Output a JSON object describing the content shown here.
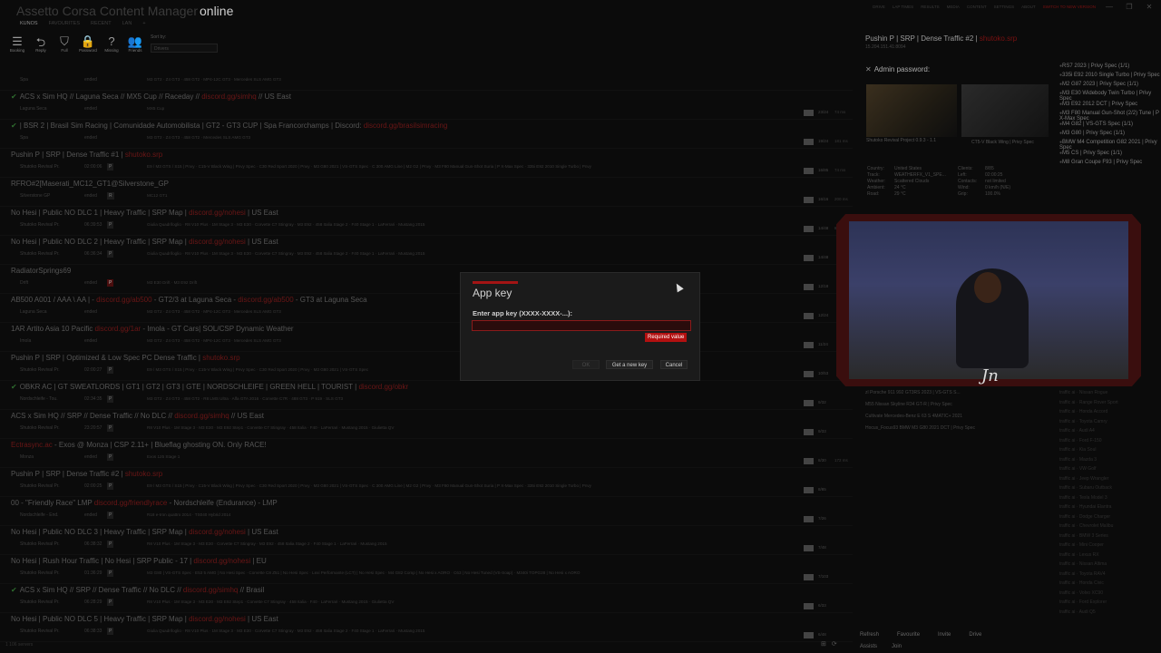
{
  "app": {
    "brand_prefix": "Assetto Corsa Content Manager",
    "brand": "online"
  },
  "nav_tabs": [
    "KUNOS",
    "FAVOURITES",
    "RECENT",
    "LAN",
    "+"
  ],
  "window_controls": [
    "—",
    "❐",
    "✕"
  ],
  "top_menu": [
    "DRIVE",
    "LAP TIMES",
    "RESULTS",
    "MEDIA",
    "CONTENT",
    "SETTINGS",
    "ABOUT"
  ],
  "update_text": "SWITCH TO NEW VERSION",
  "toolbar": [
    {
      "label": "Booking",
      "icon": "booking-icon",
      "glyph": "☰"
    },
    {
      "label": "Reply",
      "icon": "reply-icon",
      "glyph": "⮌"
    },
    {
      "label": "Full",
      "icon": "full-icon",
      "glyph": "⛉"
    },
    {
      "label": "Password",
      "icon": "lock-icon",
      "glyph": "🔒"
    },
    {
      "label": "Missing",
      "icon": "question-icon",
      "glyph": "?"
    },
    {
      "label": "Friends",
      "icon": "friends-icon",
      "glyph": "👥"
    }
  ],
  "sort": {
    "label": "Sort by:",
    "value": "Drivers"
  },
  "servers": [
    {
      "name": "",
      "track": "Spa",
      "state": "ended",
      "pill": "",
      "cars": "M3 GT2   ·   Z4 GT3   ·   458 GT2   ·   MP4-12C GT3   ·   Mercedes SLS AMG GT3",
      "count": "",
      "ping": ""
    },
    {
      "check": true,
      "name": "ACS x Sim HQ // Laguna Seca // MX5 Cup // Raceday // ",
      "red": "discord.gg/simhq",
      "name_after": " // US East",
      "track": "Laguna Seca",
      "state": "ended",
      "pill": "",
      "cars": "MX5 Cup",
      "count": "23/24",
      "ping": "74 ms"
    },
    {
      "check": true,
      "name": "| BSR 2 | Brasil Sim Racing | Comunidade Automobilista | GT2 - GT3 CUP | Spa Francorchamps | Discord: ",
      "red": "discord.gg/brasilsimracing",
      "name_after": "",
      "track": "Spa",
      "state": "ended",
      "pill": "",
      "cars": "M3 GT2   ·   Z4 GT3   ·   458 GT2   ·   Mercedes SLS AMG GT3",
      "count": "19/24",
      "ping": "181 ms"
    },
    {
      "name": "Pushin P | SRP | Dense Traffic #1 | ",
      "red": "shutoko.srp",
      "name_after": "",
      "track": "Shutoko Revival Pr.",
      "state": "02:00:06",
      "pill": "P",
      "cars": "E9 / M3 GTS / S15 | Pnvy   ·   C15-V Black Wing | Pnvy Spec   ·   C30 Red Sport 2020 | Pnvy   ·   M3 G80 2021 | VS-GTS Spec   ·   C 300 AMG Line | M2 G2 | Pnvy   ·   M3 F80 Manual Gun-Shot Suria | P X-Max Spec   ·   335i E92 2010 Single Turbo | Pnvy",
      "count": "16/85",
      "ping": "74 ms"
    },
    {
      "name": "RFRO#2[Maserati_MC12_GT1@Silverstone_GP",
      "red": "",
      "name_after": "",
      "track": "Silverstone GP",
      "state": "ended",
      "pill": "R",
      "cars": "MC12 GT1",
      "count": "16/16",
      "ping": "200 ms"
    },
    {
      "name": "No Hesi | Public NO DLC 1 | Heavy Traffic | SRP Map | ",
      "red": "discord.gg/nohesi",
      "name_after": " | US East",
      "track": "Shutoko Revival Pr.",
      "state": "06:39:53",
      "pill": "P",
      "cars": "Giulia Quadrifoglio   ·   R8 V10 Plus   ·   1M Stage 3   ·   M3 E30   ·   Corvette C7 Stingray   ·   M3 E92   ·   458 Italia Stage 2   ·   F40 Stage 1   ·   LaFerrari   ·   Mustang 2015",
      "count": "14/48",
      "ping": "82 ms"
    },
    {
      "name": "No Hesi | Public NO DLC 2 | Heavy Traffic | SRP Map | ",
      "red": "discord.gg/nohesi",
      "name_after": " | US East",
      "track": "Shutoko Revival Pr.",
      "state": "06:36:34",
      "pill": "P",
      "cars": "Giulia Quadrifoglio   ·   R8 V10 Plus   ·   1M Stage 3   ·   M3 E30   ·   Corvette C7 Stingray   ·   M3 E92   ·   458 Italia Stage 2   ·   F40 Stage 1   ·   LaFerrari   ·   Mustang 2015",
      "count": "14/48",
      "ping": ""
    },
    {
      "name": "RadiatorSprings69",
      "red": "",
      "name_after": "",
      "track": "Drift",
      "state": "ended",
      "pill": "P",
      "pill_red": true,
      "cars": "M3 E30 Drift   ·   M3 E92 Drift",
      "count": "12/18",
      "ping": ""
    },
    {
      "name": "AB500 A001 / AAA \\ AA | - ",
      "red": "discord.gg/ab500",
      "name_after": " - GT2/3 at Laguna Seca - ",
      "red2": "discord.gg/ab500",
      "name_after2": " - GT3 at Laguna Seca",
      "track": "Laguna Seca",
      "state": "ended",
      "pill": "",
      "cars": "M3 GT2   ·   Z4 GT3   ·   458 GT2   ·   MP4-12C GT3   ·   Mercedes SLS AMG GT3",
      "count": "12/24",
      "ping": ""
    },
    {
      "name": "1AR Artito Asia 10 Pacific ",
      "red": "discord.gg/1ar",
      "name_after": " - Imola - GT Cars| SOL/CSP Dynamic Weather",
      "track": "Imola",
      "state": "ended",
      "pill": "",
      "cars": "M3 GT2   ·   Z4 GT3   ·   458 GT2   ·   MP4-12C GT3   ·   Mercedes SLS AMG GT3",
      "count": "11/24",
      "ping": ""
    },
    {
      "name": "Pushin P | SRP | Optimized & Low Spec PC Dense Traffic | ",
      "red": "shutoko.srp",
      "name_after": "",
      "track": "Shutoko Revival Pr.",
      "state": "02:00:27",
      "pill": "P",
      "cars": "E9 / M3 GTS / S15 | Pnvy   ·   C15-V Black Wing | Pnvy Spec   ·   C30 Red Sport 2020 | Pnvy   ·   M3 G80 2021 | VS-GTS Spec",
      "count": "10/53",
      "ping": ""
    },
    {
      "check": true,
      "name": "OBKR AC | GT SWEATLORDS | GT1 | GT2 | GT3 | GTE | NORDSCHLEIFE | GREEN HELL | TOURIST | ",
      "red": "discord.gg/obkr",
      "name_after": "",
      "track": "Nordschleife - Tou.",
      "state": "02:34:35",
      "pill": "P",
      "cars": "M3 GT2   ·   Z4 GT3   ·   458 GT2   ·   R8 LMS Ultra   ·   Alfa GTA 2016   ·   Corvette C7R   ·   488 GT3   ·   P 919   ·   SLS GT3",
      "count": "9/32",
      "ping": ""
    },
    {
      "name": "ACS x Sim HQ // SRP // Dense Traffic // No DLC // ",
      "red": "discord.gg/simhq",
      "name_after": " // US East",
      "track": "Shutoko Revival Pr.",
      "state": "23:20:57",
      "pill": "P",
      "cars": "R8 V10 Plus   ·   1M Stage 3   ·   M3 E30   ·   M3 E92 Step1   ·   Corvette C7 Stingray   ·   458 Italia   ·   F40   ·   LaFerrari   ·   Mustang 2015   ·   Giulietta QV",
      "count": "9/33",
      "ping": ""
    },
    {
      "name": "",
      "red": "Ectrasync.ac",
      "name_after": " - Exos @ Monza | CSP 2.11+ | Blueflag ghosting ON. Only RACE!",
      "track": "Monza",
      "state": "ended",
      "pill": "P",
      "cars": "Exos 125 Stage 1",
      "count": "8/30",
      "ping": "172 ms"
    },
    {
      "name": "Pushin P | SRP | Dense Traffic #2 | ",
      "red": "shutoko.srp",
      "name_after": "",
      "track": "Shutoko Revival Pr.",
      "state": "02:00:25",
      "pill": "P",
      "cars": "E9 / M3 GTS / S15 | Pnvy   ·   C15-V Black Wing | Pnvy Spec   ·   C30 Red Sport 2020 | Pnvy   ·   M3 G80 2021 | VS-GTS Spec   ·   C 300 AMG Line | M2 G2 | Pnvy   ·   M3 F80 Manual Gun-Shot Suria | P X-Max Spec   ·   335i E92 2010 Single Turbo | Pnvy",
      "count": "8/85",
      "ping": ""
    },
    {
      "name": "00 - \"Friendly Race\" LMP ",
      "red": "discord.gg/friendlyrace",
      "name_after": " - Nordschleife (Endurance) - LMP",
      "track": "Nordschleife - End.",
      "state": "ended",
      "pill": "P",
      "cars": "R18 e-tron quattro 2014   ·   TS040 Hybrid 2014",
      "count": "7/26",
      "ping": ""
    },
    {
      "name": "No Hesi | Public NO DLC 3 | Heavy Traffic | SRP Map | ",
      "red": "discord.gg/nohesi",
      "name_after": " | US East",
      "track": "Shutoko Revival Pr.",
      "state": "06:38:32",
      "pill": "P",
      "cars": "R8 V10 Plus   ·   1M Stage 3   ·   M3 E30   ·   Corvette C7 Stingray   ·   M3 E92   ·   458 Italia Stage 2   ·   F40 Stage 1   ·   LaFerrari   ·   Mustang 2015",
      "count": "7/48",
      "ping": ""
    },
    {
      "name": "No Hesi | Rush Hour Traffic | No Hesi | SRP Public - 17 | ",
      "red": "discord.gg/nohesi",
      "name_after": " | EU",
      "track": "Shutoko Revival Pr.",
      "state": "01:36:29",
      "pill": "P",
      "cars": "M3 G80 | VS-GTS Spec   ·   E53 5 AMG | No Hesi Spec   ·   Corvette C8 Z51 | No Hesi Spec   ·   Lexi Performante (LCT) | No Hesi Spec   ·   M4 G82 Comp | No Hesi x AORO   ·   C63 | No Hesi Tuned (VS-Soap)   ·   M340i TOPG28 | No Hesi x AORO",
      "count": "7/103",
      "ping": ""
    },
    {
      "check": true,
      "name": "ACS x Sim HQ // SRP // Dense Traffic // No DLC // ",
      "red": "discord.gg/simhq",
      "name_after": " // Brasil",
      "track": "Shutoko Revival Pr.",
      "state": "06:28:29",
      "pill": "P",
      "cars": "R8 V10 Plus   ·   1M Stage 3   ·   M3 E30   ·   M3 E92 Step1   ·   Corvette C7 Stingray   ·   458 Italia   ·   F40   ·   LaFerrari   ·   Mustang 2015   ·   Giulietta QV",
      "count": "6/33",
      "ping": ""
    },
    {
      "name": "No Hesi | Public NO DLC 5 | Heavy Traffic | SRP Map | ",
      "red": "discord.gg/nohesi",
      "name_after": " | US East",
      "track": "Shutoko Revival Pr.",
      "state": "06:38:33",
      "pill": "P",
      "cars": "Giulia Quadrifoglio   ·   R8 V10 Plus   ·   1M Stage 3   ·   M3 E30   ·   Corvette C7 Stingray   ·   M3 E92   ·   458 Italia Stage 2   ·   F40 Stage 1   ·   LaFerrari   ·   Mustang 2015",
      "count": "6/48",
      "ping": ""
    },
    {
      "name": "No Hesi | Rush Hour Traffic | No Hesi | SRP Public - 1 | ",
      "red": "",
      "name_after": " | US East",
      "track": "",
      "state": "",
      "pill": "",
      "cars": "",
      "count": "",
      "ping": ""
    }
  ],
  "status_bar": "1 106 servers",
  "detail": {
    "title": "Pushin P | SRP | Dense Traffic #2 | ",
    "title_red": "shutoko.srp",
    "subtitle": "15.204.151.41:8094",
    "admin_label": "Admin password:",
    "cap1_title": "Shutoko Revival Project 0.9.3 - 1.1",
    "cap2_title": "CT5-V Black Wing | Privy Spec",
    "info": [
      [
        "Country:",
        "United States",
        "Clients:",
        "8/85"
      ],
      [
        "Track:",
        "WEATHERFX_V1_SPE...",
        "Left:",
        "02:00:25"
      ],
      [
        "Weather:",
        "Scattered Clouds",
        "Contacts:",
        "not limited"
      ],
      [
        "Ambient:",
        "24 °C",
        "Wind:",
        "0 km/h (N/E)"
      ],
      [
        "Road:",
        "29 °C",
        "Grip:",
        "100.0%"
      ]
    ],
    "side_list": [
      "RS7 2023 | Privy Spec (1/1)",
      "335i E92 2010 Single Turbo | Privy Spec",
      "M2 G87 2023 | Privy Spec (1/1)",
      "M3 E30 Widebody Twin Turbo | Privy Spec",
      "M3 E92 2012 DCT | Privy Spec",
      "M3 F80 Manual Gun-Shot (2/2) Tune | P X-Max Spec",
      "M4 G82 | VS-GTS Spec (1/1)",
      "M3 G80 | Privy Spec (1/1)",
      "BMW M4 Competition G82 2021 | Privy Spec",
      "M5 CS | Privy Spec (1/1)",
      "M8 Gran Coupe F93 | Privy Spec"
    ],
    "drivers": [
      "zl  Porsche 911 992 GT3RS 2023 | VS-GTS S...",
      "M55  Nissan Skyline R34 GT-R | Privy Spec",
      "Cultivate  Mercedes-Benz E 63 S 4MATIC+ 2021",
      "Hocus_Focus93  BMW M3 G80 2021 DCT | Privy Spec"
    ],
    "chat": [
      "traffic ai   ·   Nissan Rogue",
      "traffic ai   ·   Range Rover Sport",
      "traffic ai   ·   Honda Accord",
      "traffic ai   ·   Toyota Camry",
      "traffic ai   ·   Audi A4",
      "traffic ai   ·   Ford F-150",
      "traffic ai   ·   Kia Soul",
      "traffic ai   ·   Mazda 3",
      "traffic ai   ·   VW Golf",
      "traffic ai   ·   Jeep Wrangler",
      "traffic ai   ·   Subaru Outback",
      "traffic ai   ·   Tesla Model 3",
      "traffic ai   ·   Hyundai Elantra",
      "traffic ai   ·   Dodge Charger",
      "traffic ai   ·   Chevrolet Malibu",
      "traffic ai   ·   BMW 3 Series",
      "traffic ai   ·   Mini Cooper",
      "traffic ai   ·   Lexus RX",
      "traffic ai   ·   Nissan Altima",
      "traffic ai   ·   Toyota RAV4",
      "traffic ai   ·   Honda Civic",
      "traffic ai   ·   Volvo XC90",
      "traffic ai   ·   Ford Explorer",
      "traffic ai   ·   Audi Q5"
    ],
    "actions": [
      "Refresh",
      "Favourite",
      "Invite",
      "Drive"
    ],
    "actions2": [
      "Assists",
      "Join"
    ]
  },
  "webcam": {
    "signature": "Jn"
  },
  "dialog": {
    "title": "App key",
    "prompt": "Enter app key (XXXX-XXXX-...):",
    "input_value": "",
    "error": "Required value",
    "ok": "OK",
    "get_key": "Get a new key",
    "cancel": "Cancel"
  },
  "colors": {
    "accent": "#a31414",
    "error": "#b31010",
    "bg": "#0b0b0b",
    "dialog_bg": "#1b1b1b"
  }
}
